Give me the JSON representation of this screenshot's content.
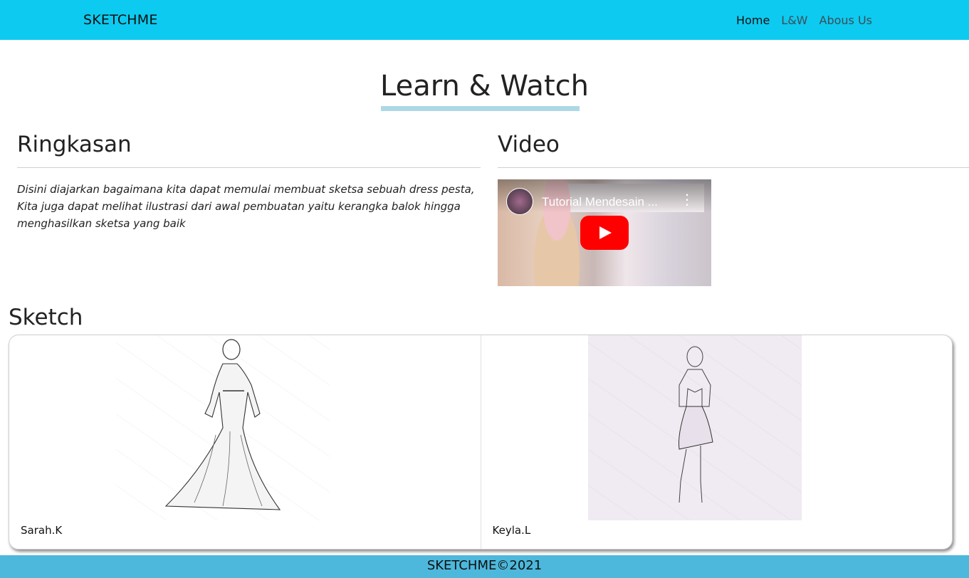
{
  "navbar": {
    "brand": "SKETCHME",
    "links": [
      "Home",
      "L&W",
      "Abous Us"
    ]
  },
  "page_title": "Learn & Watch",
  "summary": {
    "heading": "Ringkasan",
    "text": "Disini diajarkan bagaimana kita dapat memulai membuat sketsa sebuah dress pesta, Kita juga dapat melihat ilustrasi dari awal pembuatan yaitu kerangka balok hingga menghasilkan sketsa yang baik"
  },
  "video": {
    "heading": "Video",
    "title": "Tutorial Mendesain ...",
    "colors": {
      "play_button": "#ff0000"
    }
  },
  "sketch": {
    "heading": "Sketch",
    "cards": [
      {
        "caption": "Sarah.K"
      },
      {
        "caption": "Keyla.L"
      }
    ]
  },
  "footer": {
    "text": "SKETCHME©2021"
  },
  "colors": {
    "navbar": "#0dcaf0",
    "footer": "#4db8dc",
    "title_underline": "#add8e6"
  }
}
